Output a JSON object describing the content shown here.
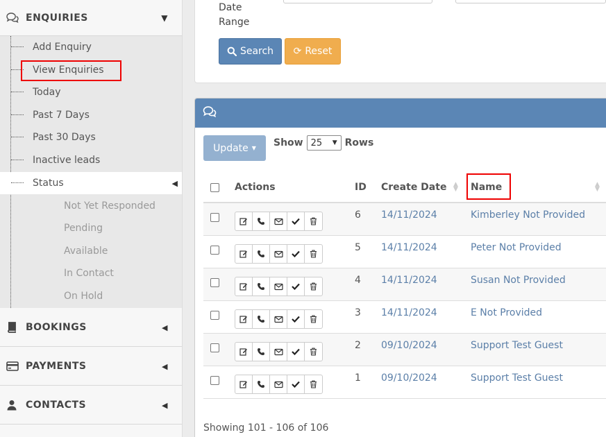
{
  "sidebar": {
    "enquiries_title": "ENQUIRIES",
    "items": [
      {
        "label": "Add Enquiry"
      },
      {
        "label": "View Enquiries"
      },
      {
        "label": "Today"
      },
      {
        "label": "Past 7 Days"
      },
      {
        "label": "Past 30 Days"
      },
      {
        "label": "Inactive leads"
      },
      {
        "label": "Status"
      }
    ],
    "status_items": [
      {
        "label": "Not Yet Responded"
      },
      {
        "label": "Pending"
      },
      {
        "label": "Available"
      },
      {
        "label": "In Contact"
      },
      {
        "label": "On Hold"
      }
    ],
    "bookings_title": "BOOKINGS",
    "payments_title": "PAYMENTS",
    "contacts_title": "CONTACTS"
  },
  "filter": {
    "date_range_label": "Date Range",
    "search_label": "Search",
    "reset_label": "Reset"
  },
  "table_controls": {
    "update_label": "Update",
    "show_label": "Show",
    "rows_value": "25",
    "rows_label": "Rows"
  },
  "table": {
    "headers": {
      "actions": "Actions",
      "id": "ID",
      "create_date": "Create Date",
      "name": "Name"
    },
    "rows": [
      {
        "id": "6",
        "date": "14/11/2024",
        "name": "Kimberley Not Provided"
      },
      {
        "id": "5",
        "date": "14/11/2024",
        "name": "Peter Not Provided"
      },
      {
        "id": "4",
        "date": "14/11/2024",
        "name": "Susan Not Provided"
      },
      {
        "id": "3",
        "date": "14/11/2024",
        "name": "E Not Provided"
      },
      {
        "id": "2",
        "date": "09/10/2024",
        "name": "Support Test Guest"
      },
      {
        "id": "1",
        "date": "09/10/2024",
        "name": "Support Test Guest"
      }
    ],
    "footer": "Showing 101 - 106 of 106"
  },
  "colors": {
    "primary": "#5b86b5",
    "warning": "#f0ad4e",
    "link": "#5b7fa8",
    "highlight": "#e00000"
  }
}
